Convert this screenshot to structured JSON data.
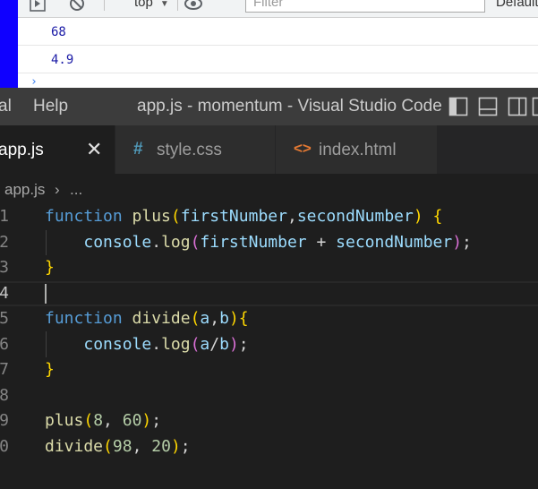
{
  "devtools": {
    "context_selector": "top",
    "filter_placeholder": "Filter",
    "levels_label": "Default l",
    "console_output": [
      "68",
      "4.9"
    ],
    "prompt_symbol": "›"
  },
  "titlebar": {
    "menu": [
      "al",
      "Help"
    ],
    "window_title": "app.js - momentum - Visual Studio Code"
  },
  "tabs": [
    {
      "label": "app.js",
      "glyph": "",
      "close": "✕",
      "active": true
    },
    {
      "label": "style.css",
      "glyph": "#",
      "glyph_color": "#519aba",
      "active": false
    },
    {
      "label": "index.html",
      "glyph": "<>",
      "glyph_color": "#e37933",
      "active": false
    }
  ],
  "breadcrumb": {
    "file": "app.js",
    "separator": "›",
    "rest": "..."
  },
  "editor": {
    "line_numbers": [
      "1",
      "2",
      "3",
      "4",
      "5",
      "6",
      "7",
      "8",
      "9",
      "0"
    ],
    "current_line": 4,
    "lines": [
      [
        {
          "t": "function",
          "c": "kw"
        },
        {
          "t": " ",
          "c": "pl"
        },
        {
          "t": "plus",
          "c": "fn"
        },
        {
          "t": "(",
          "c": "b1"
        },
        {
          "t": "firstNumber",
          "c": "var"
        },
        {
          "t": ",",
          "c": "pl"
        },
        {
          "t": "secondNumber",
          "c": "var"
        },
        {
          "t": ")",
          "c": "b1"
        },
        {
          "t": " ",
          "c": "pl"
        },
        {
          "t": "{",
          "c": "b1"
        }
      ],
      [
        {
          "t": "    ",
          "c": "pl"
        },
        {
          "t": "console",
          "c": "var"
        },
        {
          "t": ".",
          "c": "pl"
        },
        {
          "t": "log",
          "c": "fn"
        },
        {
          "t": "(",
          "c": "b2"
        },
        {
          "t": "firstNumber",
          "c": "var"
        },
        {
          "t": " + ",
          "c": "pl"
        },
        {
          "t": "secondNumber",
          "c": "var"
        },
        {
          "t": ")",
          "c": "b2"
        },
        {
          "t": ";",
          "c": "pl"
        }
      ],
      [
        {
          "t": "}",
          "c": "b1"
        }
      ],
      [],
      [
        {
          "t": "function",
          "c": "kw"
        },
        {
          "t": " ",
          "c": "pl"
        },
        {
          "t": "divide",
          "c": "fn"
        },
        {
          "t": "(",
          "c": "b1"
        },
        {
          "t": "a",
          "c": "var"
        },
        {
          "t": ",",
          "c": "pl"
        },
        {
          "t": "b",
          "c": "var"
        },
        {
          "t": ")",
          "c": "b1"
        },
        {
          "t": "{",
          "c": "b1"
        }
      ],
      [
        {
          "t": "    ",
          "c": "pl"
        },
        {
          "t": "console",
          "c": "var"
        },
        {
          "t": ".",
          "c": "pl"
        },
        {
          "t": "log",
          "c": "fn"
        },
        {
          "t": "(",
          "c": "b2"
        },
        {
          "t": "a",
          "c": "var"
        },
        {
          "t": "/",
          "c": "pl"
        },
        {
          "t": "b",
          "c": "var"
        },
        {
          "t": ")",
          "c": "b2"
        },
        {
          "t": ";",
          "c": "pl"
        }
      ],
      [
        {
          "t": "}",
          "c": "b1"
        }
      ],
      [],
      [
        {
          "t": "plus",
          "c": "fn"
        },
        {
          "t": "(",
          "c": "b1"
        },
        {
          "t": "8",
          "c": "num"
        },
        {
          "t": ", ",
          "c": "pl"
        },
        {
          "t": "60",
          "c": "num"
        },
        {
          "t": ")",
          "c": "b1"
        },
        {
          "t": ";",
          "c": "pl"
        }
      ],
      [
        {
          "t": "divide",
          "c": "fn"
        },
        {
          "t": "(",
          "c": "b1"
        },
        {
          "t": "98",
          "c": "num"
        },
        {
          "t": ", ",
          "c": "pl"
        },
        {
          "t": "20",
          "c": "num"
        },
        {
          "t": ")",
          "c": "b1"
        },
        {
          "t": ";",
          "c": "pl"
        }
      ]
    ]
  }
}
